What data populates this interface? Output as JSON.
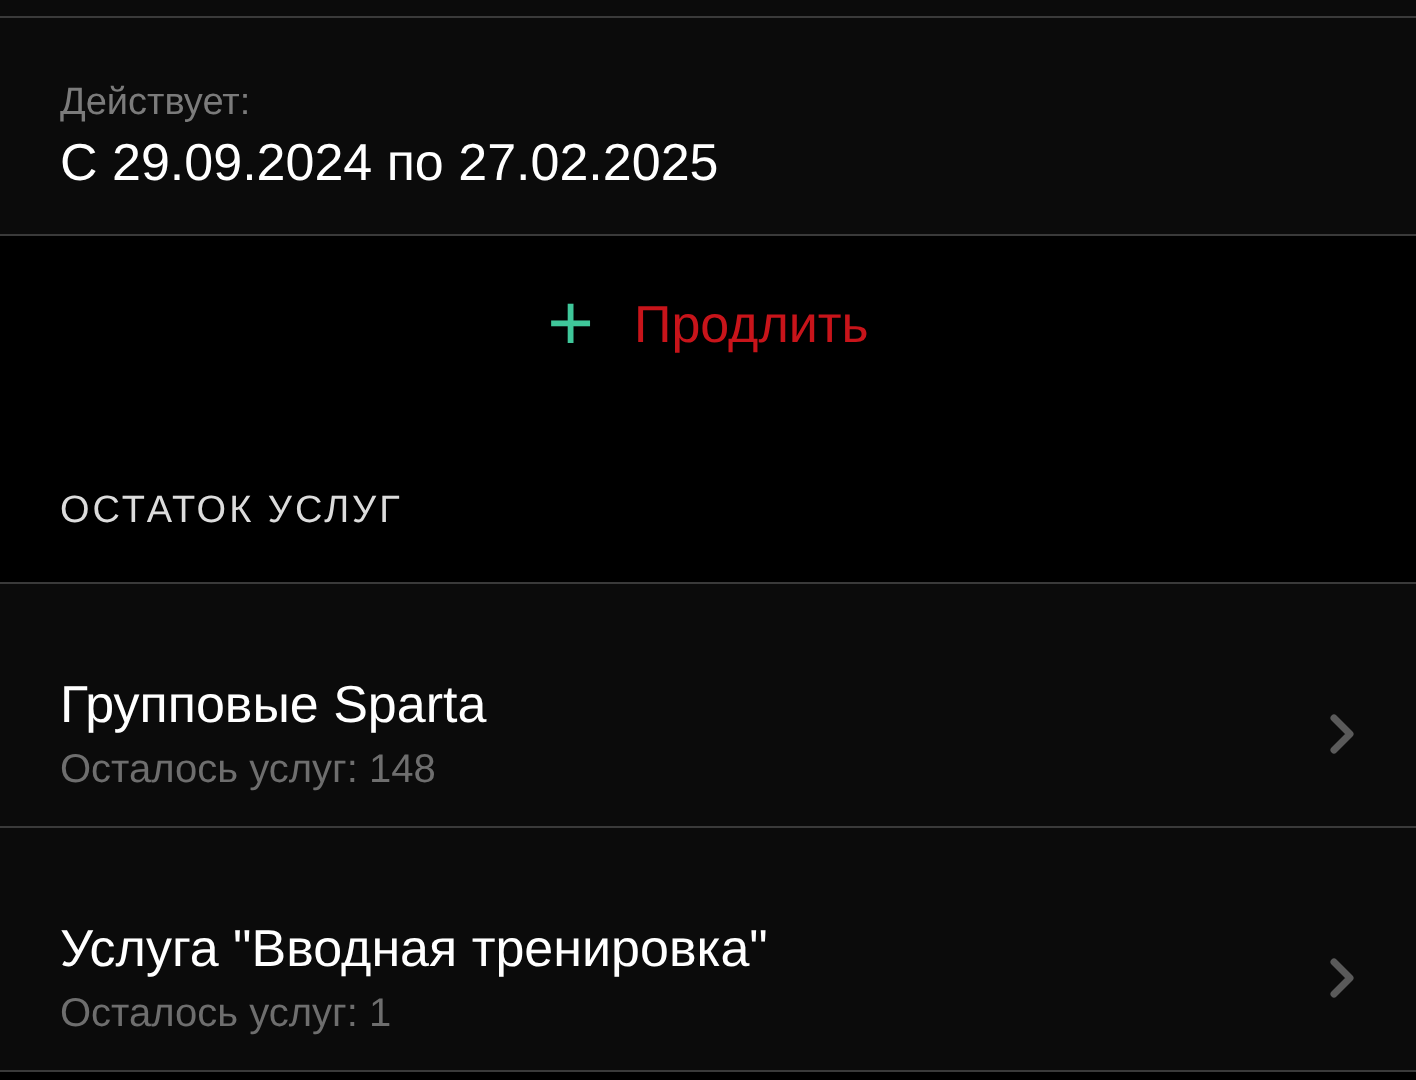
{
  "validity": {
    "label": "Действует:",
    "value": "С 29.09.2024 по 27.02.2025"
  },
  "extend_button": {
    "icon": "+",
    "label": "Продлить"
  },
  "section_header": "ОСТАТОК УСЛУГ",
  "services": [
    {
      "title": "Групповые Sparta",
      "subtitle": "Осталось услуг: 148"
    },
    {
      "title": "Услуга \"Вводная тренировка\"",
      "subtitle": "Осталось услуг: 1"
    }
  ]
}
